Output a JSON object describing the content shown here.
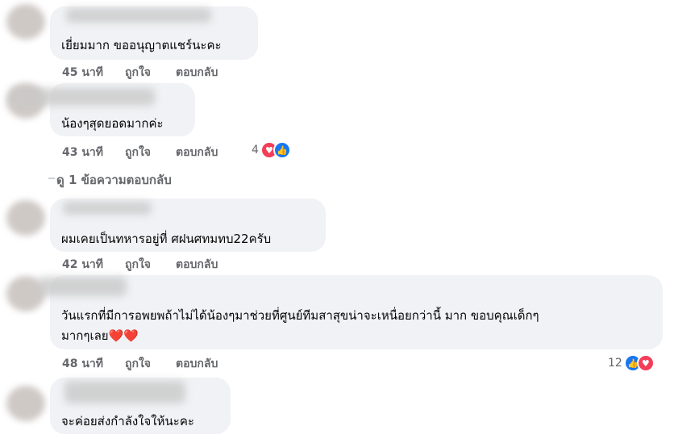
{
  "comments": [
    {
      "text": "เยี่ยมมาก ขออนุญาตแชร์นะคะ",
      "time": "45 นาที",
      "like": "ถูกใจ",
      "reply": "ตอบกลับ"
    },
    {
      "text": "น้องๆสุดยอดมากค่ะ",
      "time": "43 นาที",
      "like": "ถูกใจ",
      "reply": "ตอบกลับ",
      "reaction_count": "4"
    },
    {
      "text": "ผมเคยเป็นทหารอยู่ที่ ศฝนศทมทบ22ครับ",
      "time": "42 นาที",
      "like": "ถูกใจ",
      "reply": "ตอบกลับ"
    },
    {
      "text_line1": "วันแรกที่มีการอพยพถ้าไม่ได้น้องๆมาช่วยที่ศูนย์ทีมสาสุขน่าจะเหนื่อยกว่านี้ มาก ขอบคุณเด็กๆ",
      "text_line2": "มากๆเลย❤️❤️",
      "time": "48 นาที",
      "like": "ถูกใจ",
      "reply": "ตอบกลับ",
      "reaction_count": "12"
    },
    {
      "text": "จะค่อยส่งกำลังใจให้นะคะ"
    }
  ],
  "view_replies": "ดู 1 ข้อความตอบกลับ",
  "icons": {
    "heart": "heart-icon",
    "like": "like-icon"
  },
  "colors": {
    "bubble": "#f0f2f5",
    "meta": "#65676b",
    "heart": "#f33e58",
    "like": "#1877f2"
  }
}
